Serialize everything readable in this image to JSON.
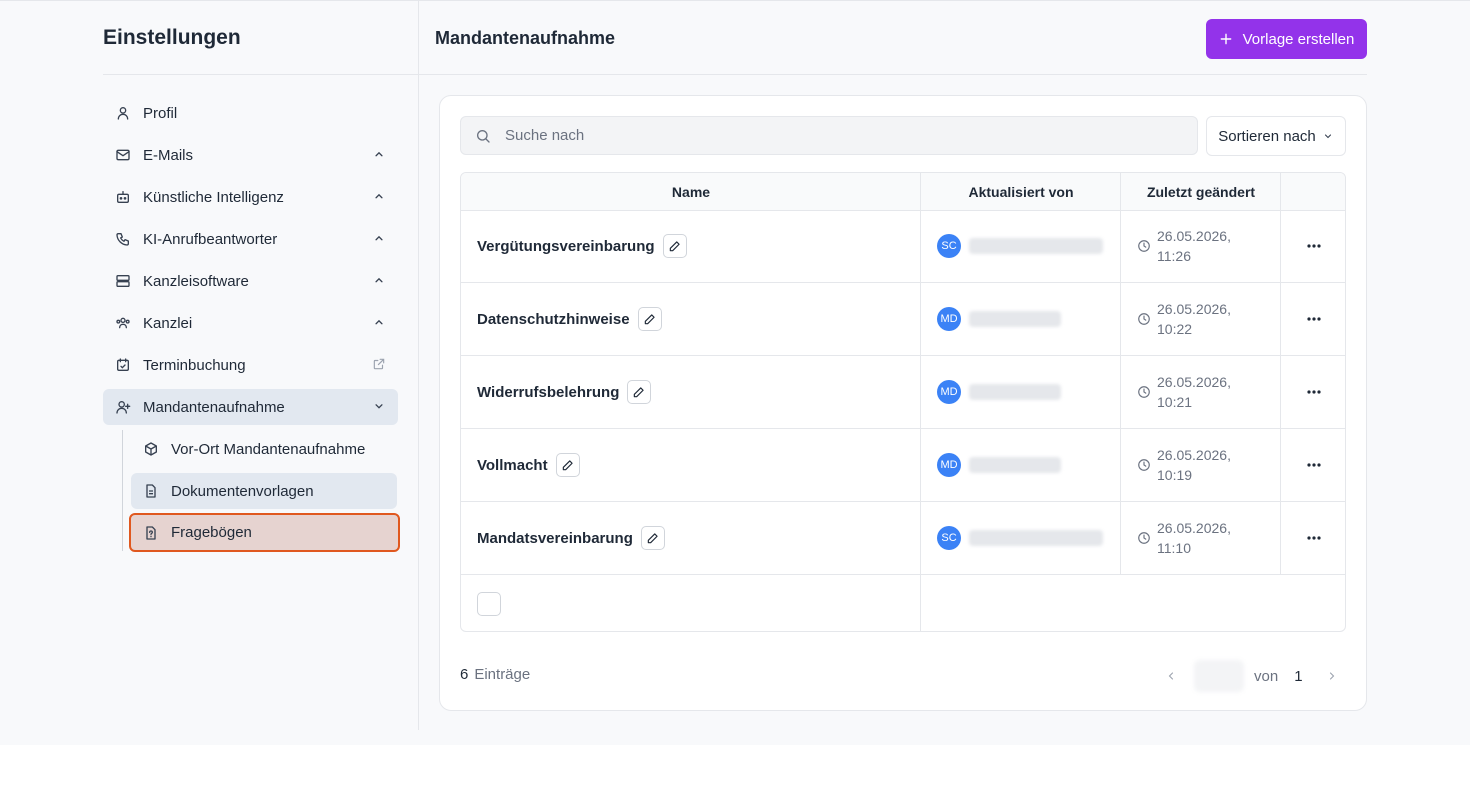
{
  "sidebar": {
    "title": "Einstellungen",
    "items": [
      {
        "label": "Profil",
        "icon": "user-icon"
      },
      {
        "label": "E-Mails",
        "icon": "mail-icon"
      },
      {
        "label": "Künstliche Intelligenz",
        "icon": "bot-icon"
      },
      {
        "label": "KI-Anrufbeantworter",
        "icon": "phone-icon"
      },
      {
        "label": "Kanzleisoftware",
        "icon": "server-icon"
      },
      {
        "label": "Kanzlei",
        "icon": "users-icon"
      },
      {
        "label": "Terminbuchung",
        "icon": "calendar-check-icon"
      },
      {
        "label": "Mandantenaufnahme",
        "icon": "user-plus-icon"
      }
    ],
    "subitems": [
      {
        "label": "Vor-Ort Mandantenaufnahme",
        "icon": "package-icon"
      },
      {
        "label": "Dokumentenvorlagen",
        "icon": "file-text-icon"
      },
      {
        "label": "Fragebögen",
        "icon": "file-question-icon"
      }
    ]
  },
  "main": {
    "title": "Mandantenaufnahme",
    "create_label": "Vorlage erstellen"
  },
  "toolbar": {
    "search_placeholder": "Suche nach",
    "sort_label": "Sortieren nach"
  },
  "table": {
    "headers": [
      "Name",
      "Aktualisiert von",
      "Zuletzt geändert"
    ],
    "rows": [
      {
        "name": "Vergütungsvereinbarung",
        "initials": "SC",
        "date": "26.05.2026,",
        "time": "11:26"
      },
      {
        "name": "Datenschutzhinweise",
        "initials": "MD",
        "date": "26.05.2026,",
        "time": "10:22"
      },
      {
        "name": "Widerrufsbelehrung",
        "initials": "MD",
        "date": "26.05.2026,",
        "time": "10:21"
      },
      {
        "name": "Vollmacht",
        "initials": "MD",
        "date": "26.05.2026,",
        "time": "10:19"
      },
      {
        "name": "Mandatsvereinbarung",
        "initials": "SC",
        "date": "26.05.2026,",
        "time": "11:10"
      }
    ]
  },
  "footer": {
    "count": "6",
    "count_label": "Einträge",
    "of_label": "von",
    "total_pages": "1"
  },
  "colors": {
    "accent": "#9333ea",
    "avatar": "#3b82f6",
    "highlight_border": "#e0581f"
  }
}
